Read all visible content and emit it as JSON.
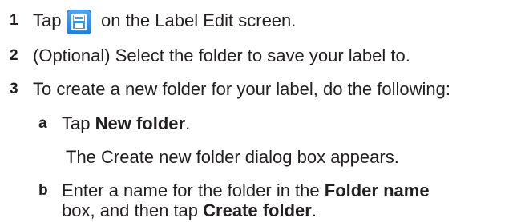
{
  "steps": [
    {
      "number": "1",
      "before_icon": "Tap",
      "icon": "save-icon",
      "after_icon": "on the Label Edit screen."
    },
    {
      "number": "2",
      "text": "(Optional) Select the folder to save your label to."
    },
    {
      "number": "3",
      "text": "To create a new folder for your label, do the following:",
      "substeps": [
        {
          "letter": "a",
          "pre": "Tap ",
          "bold": "New folder",
          "post": ".",
          "note": "The Create new folder dialog box appears."
        },
        {
          "letter": "b",
          "line1_pre": "Enter a name for the folder in the ",
          "line1_bold": "Folder name",
          "line2_pre": "box, and then tap ",
          "line2_bold": "Create folder",
          "line2_post": "."
        }
      ]
    }
  ],
  "colors": {
    "text": "#231f20",
    "icon_blue": "#2b8be6"
  }
}
